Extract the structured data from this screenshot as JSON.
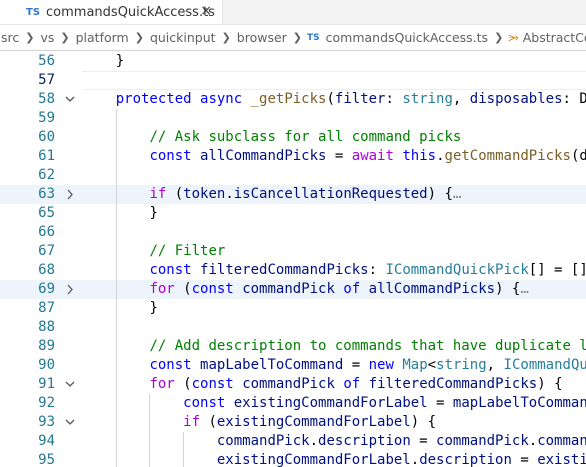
{
  "tab": {
    "badge": "TS",
    "title": "commandsQuickAccess.ts",
    "close": "×"
  },
  "breadcrumb": {
    "items": [
      "src",
      "vs",
      "platform",
      "quickinput",
      "browser"
    ],
    "file_badge": "TS",
    "file": "commandsQuickAccess.ts",
    "symbol": "AbstractComm"
  },
  "editor": {
    "lines": [
      {
        "n": "56",
        "fold": "",
        "hl": false,
        "cur": false,
        "indent": 1,
        "tokens": [
          [
            "pl",
            "}"
          ]
        ]
      },
      {
        "n": "57",
        "fold": "",
        "hl": false,
        "cur": true,
        "indent": 0,
        "tokens": []
      },
      {
        "n": "58",
        "fold": "v",
        "hl": false,
        "cur": false,
        "indent": 1,
        "tokens": [
          [
            "kw",
            "protected"
          ],
          [
            "pl",
            " "
          ],
          [
            "kw",
            "async"
          ],
          [
            "pl",
            " "
          ],
          [
            "fn",
            "_getPicks"
          ],
          [
            "pl",
            "("
          ],
          [
            "var",
            "filter"
          ],
          [
            "pl",
            ": "
          ],
          [
            "type",
            "string"
          ],
          [
            "pl",
            ", "
          ],
          [
            "var",
            "disposables"
          ],
          [
            "pl",
            ": D"
          ]
        ]
      },
      {
        "n": "59",
        "fold": "",
        "hl": false,
        "cur": false,
        "indent": 2,
        "tokens": []
      },
      {
        "n": "60",
        "fold": "",
        "hl": false,
        "cur": false,
        "indent": 2,
        "tokens": [
          [
            "cm",
            "// Ask subclass for all command picks"
          ]
        ]
      },
      {
        "n": "61",
        "fold": "",
        "hl": false,
        "cur": false,
        "indent": 2,
        "tokens": [
          [
            "kw",
            "const"
          ],
          [
            "pl",
            " "
          ],
          [
            "var",
            "allCommandPicks"
          ],
          [
            "pl",
            " = "
          ],
          [
            "ctl",
            "await"
          ],
          [
            "pl",
            " "
          ],
          [
            "kw",
            "this"
          ],
          [
            "pl",
            "."
          ],
          [
            "fn",
            "getCommandPicks"
          ],
          [
            "pl",
            "(d"
          ]
        ]
      },
      {
        "n": "62",
        "fold": "",
        "hl": false,
        "cur": false,
        "indent": 2,
        "tokens": []
      },
      {
        "n": "63",
        "fold": ">",
        "hl": true,
        "cur": false,
        "indent": 2,
        "tokens": [
          [
            "ctl",
            "if"
          ],
          [
            "pl",
            " ("
          ],
          [
            "var",
            "token"
          ],
          [
            "pl",
            "."
          ],
          [
            "var",
            "isCancellationRequested"
          ],
          [
            "pl",
            ") {"
          ],
          [
            "ell",
            "…"
          ]
        ]
      },
      {
        "n": "65",
        "fold": "",
        "hl": false,
        "cur": false,
        "indent": 2,
        "tokens": [
          [
            "pl",
            "}"
          ]
        ]
      },
      {
        "n": "66",
        "fold": "",
        "hl": false,
        "cur": false,
        "indent": 2,
        "tokens": []
      },
      {
        "n": "67",
        "fold": "",
        "hl": false,
        "cur": false,
        "indent": 2,
        "tokens": [
          [
            "cm",
            "// Filter"
          ]
        ]
      },
      {
        "n": "68",
        "fold": "",
        "hl": false,
        "cur": false,
        "indent": 2,
        "tokens": [
          [
            "kw",
            "const"
          ],
          [
            "pl",
            " "
          ],
          [
            "var",
            "filteredCommandPicks"
          ],
          [
            "pl",
            ": "
          ],
          [
            "type",
            "ICommandQuickPick"
          ],
          [
            "pl",
            "[] = []"
          ]
        ]
      },
      {
        "n": "69",
        "fold": ">",
        "hl": true,
        "cur": false,
        "indent": 2,
        "tokens": [
          [
            "ctl",
            "for"
          ],
          [
            "pl",
            " ("
          ],
          [
            "kw",
            "const"
          ],
          [
            "pl",
            " "
          ],
          [
            "var",
            "commandPick"
          ],
          [
            "pl",
            " "
          ],
          [
            "kw",
            "of"
          ],
          [
            "pl",
            " "
          ],
          [
            "var",
            "allCommandPicks"
          ],
          [
            "pl",
            ") {"
          ],
          [
            "ell",
            "…"
          ]
        ]
      },
      {
        "n": "87",
        "fold": "",
        "hl": false,
        "cur": false,
        "indent": 2,
        "tokens": [
          [
            "pl",
            "}"
          ]
        ]
      },
      {
        "n": "88",
        "fold": "",
        "hl": false,
        "cur": false,
        "indent": 2,
        "tokens": []
      },
      {
        "n": "89",
        "fold": "",
        "hl": false,
        "cur": false,
        "indent": 2,
        "tokens": [
          [
            "cm",
            "// Add description to commands that have duplicate l"
          ]
        ]
      },
      {
        "n": "90",
        "fold": "",
        "hl": false,
        "cur": false,
        "indent": 2,
        "tokens": [
          [
            "kw",
            "const"
          ],
          [
            "pl",
            " "
          ],
          [
            "var",
            "mapLabelToCommand"
          ],
          [
            "pl",
            " = "
          ],
          [
            "kw",
            "new"
          ],
          [
            "pl",
            " "
          ],
          [
            "type",
            "Map"
          ],
          [
            "pl",
            "<"
          ],
          [
            "type",
            "string"
          ],
          [
            "pl",
            ", "
          ],
          [
            "type",
            "ICommandQu"
          ]
        ]
      },
      {
        "n": "91",
        "fold": "v",
        "hl": false,
        "cur": false,
        "indent": 2,
        "tokens": [
          [
            "ctl",
            "for"
          ],
          [
            "pl",
            " ("
          ],
          [
            "kw",
            "const"
          ],
          [
            "pl",
            " "
          ],
          [
            "var",
            "commandPick"
          ],
          [
            "pl",
            " "
          ],
          [
            "kw",
            "of"
          ],
          [
            "pl",
            " "
          ],
          [
            "var",
            "filteredCommandPicks"
          ],
          [
            "pl",
            ") {"
          ]
        ]
      },
      {
        "n": "92",
        "fold": "",
        "hl": false,
        "cur": false,
        "indent": 3,
        "tokens": [
          [
            "kw",
            "const"
          ],
          [
            "pl",
            " "
          ],
          [
            "var",
            "existingCommandForLabel"
          ],
          [
            "pl",
            " = "
          ],
          [
            "var",
            "mapLabelToComman"
          ]
        ]
      },
      {
        "n": "93",
        "fold": "v",
        "hl": false,
        "cur": false,
        "indent": 3,
        "tokens": [
          [
            "ctl",
            "if"
          ],
          [
            "pl",
            " ("
          ],
          [
            "var",
            "existingCommandForLabel"
          ],
          [
            "pl",
            ") {"
          ]
        ]
      },
      {
        "n": "94",
        "fold": "",
        "hl": false,
        "cur": false,
        "indent": 4,
        "tokens": [
          [
            "var",
            "commandPick"
          ],
          [
            "pl",
            "."
          ],
          [
            "var",
            "description"
          ],
          [
            "pl",
            " = "
          ],
          [
            "var",
            "commandPick"
          ],
          [
            "pl",
            "."
          ],
          [
            "var",
            "comman"
          ]
        ]
      },
      {
        "n": "95",
        "fold": "",
        "hl": false,
        "cur": false,
        "indent": 4,
        "tokens": [
          [
            "var",
            "existingCommandForLabel"
          ],
          [
            "pl",
            "."
          ],
          [
            "var",
            "description"
          ],
          [
            "pl",
            " = "
          ],
          [
            "var",
            "existi"
          ]
        ]
      }
    ]
  }
}
